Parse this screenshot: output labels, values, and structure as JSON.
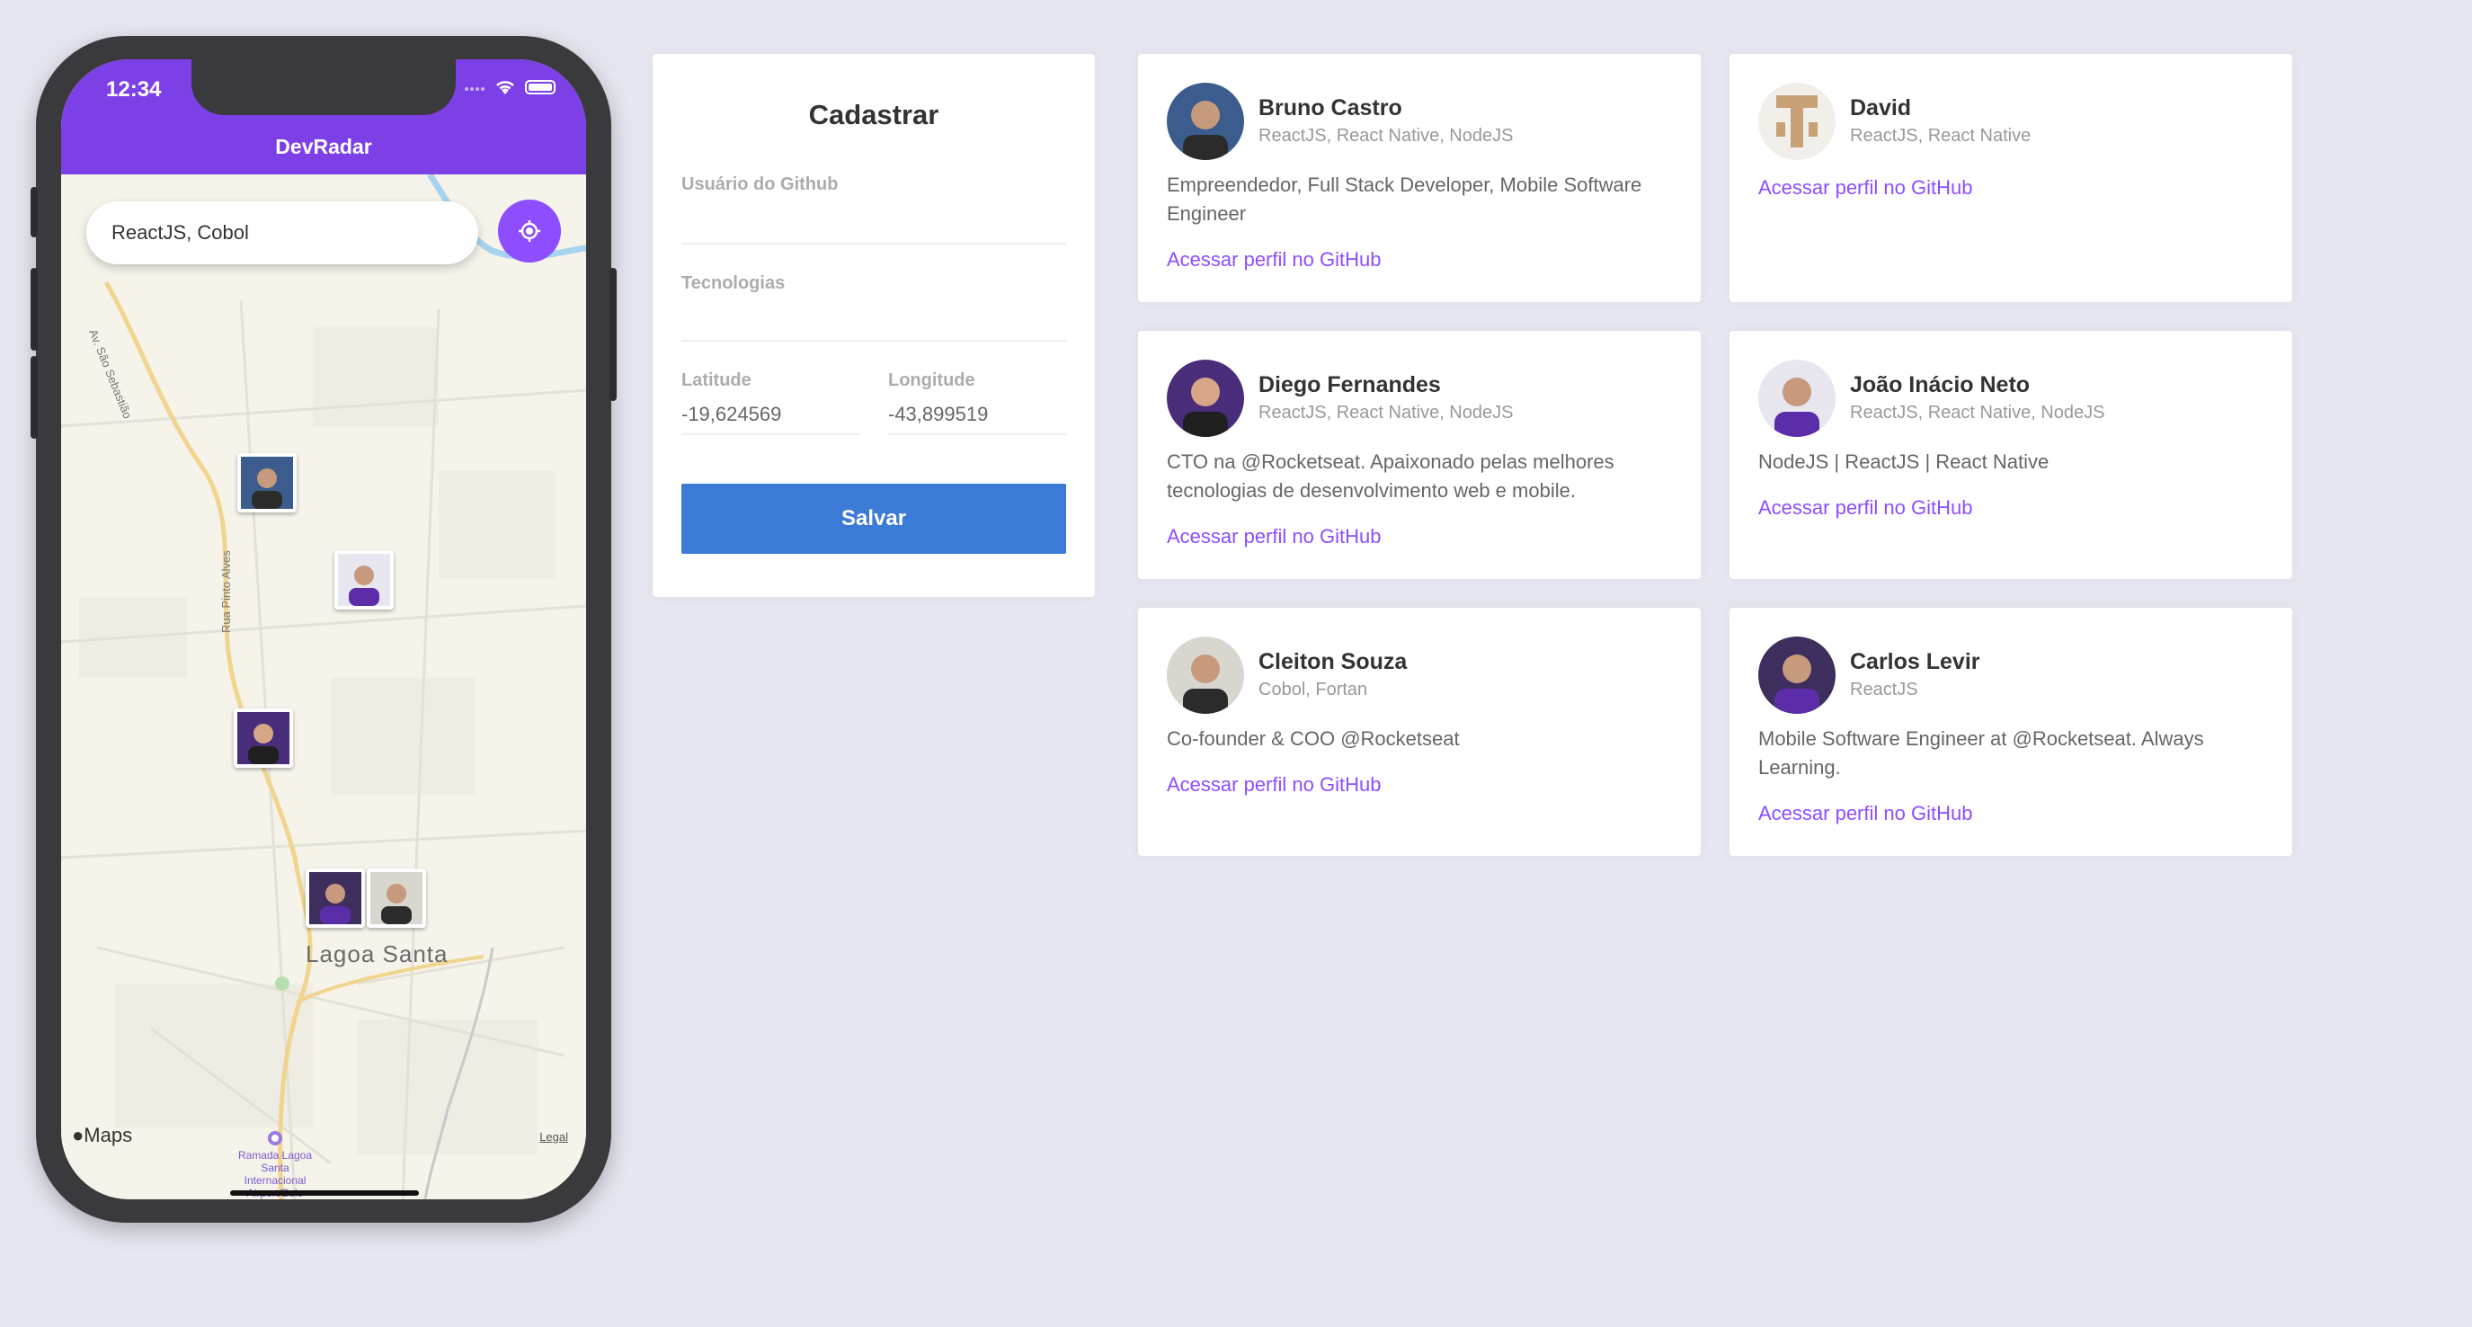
{
  "phone": {
    "time": "12:34",
    "app_title": "DevRadar",
    "search_value": "ReactJS, Cobol",
    "map": {
      "city": "Lagoa Santa",
      "road_1": "Av. São Sebastião",
      "road_2": "Rua Pinto Alves",
      "maps_logo": "Maps",
      "legal": "Legal",
      "poi": "Ramada Lagoa Santa Internacional Airport/Belo"
    }
  },
  "form": {
    "title": "Cadastrar",
    "github_label": "Usuário do Github",
    "github_value": "",
    "techs_label": "Tecnologias",
    "techs_value": "",
    "latitude_label": "Latitude",
    "latitude_value": "-19,624569",
    "longitude_label": "Longitude",
    "longitude_value": "-43,899519",
    "save_label": "Salvar"
  },
  "devs": [
    {
      "name": "Bruno Castro",
      "techs": "ReactJS, React Native, NodeJS",
      "bio": "Empreendedor, Full Stack Developer, Mobile Software Engineer",
      "link": "Acessar perfil no GitHub"
    },
    {
      "name": "David",
      "techs": "ReactJS, React Native",
      "bio": "",
      "link": "Acessar perfil no GitHub"
    },
    {
      "name": "Diego Fernandes",
      "techs": "ReactJS, React Native, NodeJS",
      "bio": "CTO na @Rocketseat. Apaixonado pelas melhores tecnologias de desenvolvimento web e mobile.",
      "link": "Acessar perfil no GitHub"
    },
    {
      "name": "João Inácio Neto",
      "techs": "ReactJS, React Native, NodeJS",
      "bio": "NodeJS | ReactJS | React Native",
      "link": "Acessar perfil no GitHub"
    },
    {
      "name": "Cleiton Souza",
      "techs": "Cobol, Fortan",
      "bio": "Co-founder & COO @Rocketseat",
      "link": "Acessar perfil no GitHub"
    },
    {
      "name": "Carlos Levir",
      "techs": "ReactJS",
      "bio": "Mobile Software Engineer at @Rocketseat. Always Learning.",
      "link": "Acessar perfil no GitHub"
    }
  ],
  "colors": {
    "accent": "#7d40e7",
    "button_blue": "#3b7bd6",
    "link": "#8e4dff",
    "background": "#e5e6f0"
  }
}
